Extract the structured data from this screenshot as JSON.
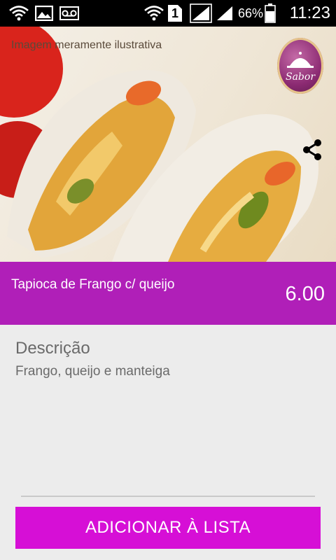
{
  "status_bar": {
    "battery_percent": "66%",
    "clock": "11:23",
    "sim_slot": "1",
    "icons": [
      "wifi-calling-icon",
      "image-icon",
      "voicemail-icon",
      "wifi-icon",
      "sim-1-icon",
      "signal-icon",
      "signal-icon",
      "battery-icon"
    ]
  },
  "hero": {
    "caption": "Imagem meramente ilustrativa",
    "logo_text": "Sabor",
    "share_icon": "share-icon"
  },
  "product": {
    "name": "Tapioca de Frango c/ queijo",
    "price": "6.00"
  },
  "description": {
    "title": "Descrição",
    "text": "Frango, queijo e manteiga"
  },
  "actions": {
    "add_label": "ADICIONAR À LISTA"
  },
  "colors": {
    "title_bar": "#b01fb8",
    "add_button": "#d60fd6",
    "background": "#ececec"
  }
}
